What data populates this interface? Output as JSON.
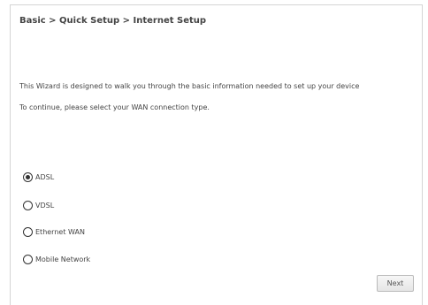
{
  "breadcrumb": "Basic > Quick Setup > Internet Setup",
  "intro": {
    "line1": "This Wizard is designed to walk you through the basic information needed to set up your device",
    "line2": "To continue, please select your WAN connection type."
  },
  "wan_options": [
    {
      "label": "ADSL",
      "checked": true
    },
    {
      "label": "VDSL",
      "checked": false
    },
    {
      "label": "Ethernet WAN",
      "checked": false
    },
    {
      "label": "Mobile Network",
      "checked": false
    }
  ],
  "buttons": {
    "next": "Next"
  }
}
